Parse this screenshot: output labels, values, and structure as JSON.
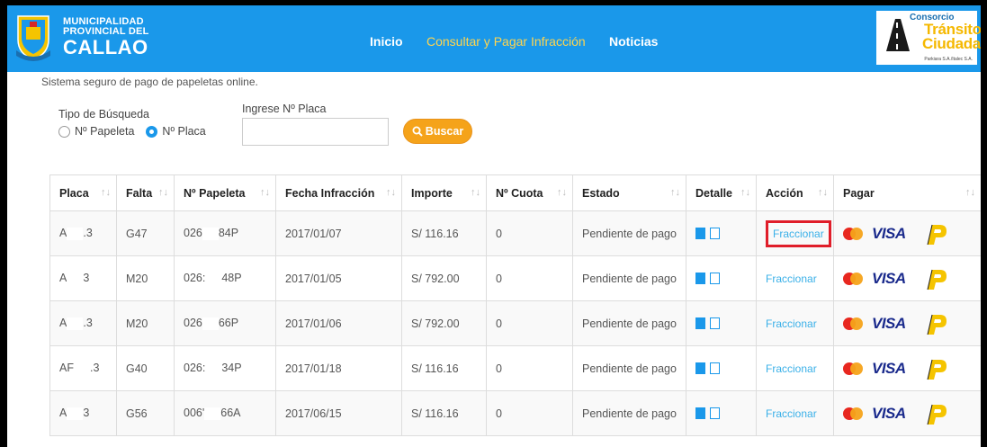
{
  "header": {
    "brand_line1": "MUNICIPALIDAD",
    "brand_line2": "PROVINCIAL DEL",
    "brand_line3": "CALLAO",
    "nav": [
      "Inicio",
      "Consultar y Pagar Infracción",
      "Noticias"
    ],
    "partner": {
      "line1": "Consorcio",
      "line2": "Tránsito",
      "line3": "Ciudadano",
      "line4": "Parkiara S.A./Italec S.A."
    }
  },
  "subtitle": "Sistema seguro de pago de papeletas online.",
  "search": {
    "tipo_label": "Tipo de Búsqueda",
    "option1": "Nº Papeleta",
    "option2": "Nº Placa",
    "selected": "Nº Placa",
    "placa_label": "Ingrese Nº Placa",
    "placa_value": "",
    "buscar_label": "Buscar"
  },
  "table": {
    "headers": [
      "Placa",
      "Falta",
      "Nº Papeleta",
      "Fecha Infracción",
      "Importe",
      "Nº Cuota",
      "Estado",
      "Detalle",
      "Acción",
      "Pagar"
    ],
    "sort_icon": "↑↓",
    "rows": [
      {
        "placa_a": "A",
        "placa_b": ".3",
        "falta": "G47",
        "pap_a": "026",
        "pap_b": "84P",
        "fecha": "2017/01/07",
        "importe": "S/ 116.16",
        "cuota": "0",
        "estado": "Pendiente de pago",
        "accion": "Fraccionar"
      },
      {
        "placa_a": "A",
        "placa_b": "3",
        "falta": "M20",
        "pap_a": "026:",
        "pap_b": "48P",
        "fecha": "2017/01/05",
        "importe": "S/ 792.00",
        "cuota": "0",
        "estado": "Pendiente de pago",
        "accion": "Fraccionar"
      },
      {
        "placa_a": "A",
        "placa_b": ".3",
        "falta": "M20",
        "pap_a": "026",
        "pap_b": "66P",
        "fecha": "2017/01/06",
        "importe": "S/ 792.00",
        "cuota": "0",
        "estado": "Pendiente de pago",
        "accion": "Fraccionar"
      },
      {
        "placa_a": "AF",
        "placa_b": ".3",
        "falta": "G40",
        "pap_a": "026:",
        "pap_b": "34P",
        "fecha": "2017/01/18",
        "importe": "S/ 116.16",
        "cuota": "0",
        "estado": "Pendiente de pago",
        "accion": "Fraccionar"
      },
      {
        "placa_a": "A",
        "placa_b": "3",
        "falta": "G56",
        "pap_a": "006'",
        "pap_b": "66A",
        "fecha": "2017/06/15",
        "importe": "S/ 116.16",
        "cuota": "0",
        "estado": "Pendiente de pago",
        "accion": "Fraccionar"
      }
    ],
    "visa_label": "VISA"
  },
  "colors": {
    "nav_bg": "#1a98ea",
    "accent": "#f5a31a",
    "link": "#3ab0e8",
    "highlight": "#e01e2a"
  }
}
